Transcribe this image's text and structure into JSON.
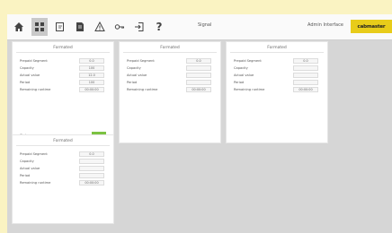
{
  "toolbar": {
    "icons": [
      "home-icon",
      "grid-icon",
      "edit-icon",
      "document-icon",
      "warning-icon",
      "key-icon",
      "logout-icon",
      "help-icon"
    ],
    "center_text": "Signal",
    "right_text": "Admin Interface",
    "logo_text": "cabmaster"
  },
  "panels": [
    {
      "title": "Formated",
      "rows": [
        {
          "label": "Prepaid Segment",
          "value": "0.0"
        },
        {
          "label": "Capacity",
          "value": "100"
        },
        {
          "label": "Actual value",
          "value": "12.0"
        },
        {
          "label": "Period",
          "value": "100"
        },
        {
          "label": "Remaining runtime",
          "value": "00:00:00"
        }
      ],
      "status_label": "Status",
      "status_color": "#7cc242"
    },
    {
      "title": "Formated",
      "rows": [
        {
          "label": "Prepaid Segment",
          "value": "0.0"
        },
        {
          "label": "Capacity",
          "value": ""
        },
        {
          "label": "Actual value",
          "value": ""
        },
        {
          "label": "Period",
          "value": ""
        },
        {
          "label": "Remaining runtime",
          "value": "00:00:00"
        }
      ]
    },
    {
      "title": "Formated",
      "rows": [
        {
          "label": "Prepaid Segment",
          "value": "0.0"
        },
        {
          "label": "Capacity",
          "value": ""
        },
        {
          "label": "Actual value",
          "value": ""
        },
        {
          "label": "Period",
          "value": ""
        },
        {
          "label": "Remaining runtime",
          "value": "00:00:00"
        }
      ]
    },
    {
      "title": "Formated",
      "rows": [
        {
          "label": "Prepaid Segment",
          "value": "0.0"
        },
        {
          "label": "Capacity",
          "value": ""
        },
        {
          "label": "Actual value",
          "value": ""
        },
        {
          "label": "Period",
          "value": ""
        },
        {
          "label": "Remaining runtime",
          "value": "00:00:00"
        }
      ]
    }
  ]
}
